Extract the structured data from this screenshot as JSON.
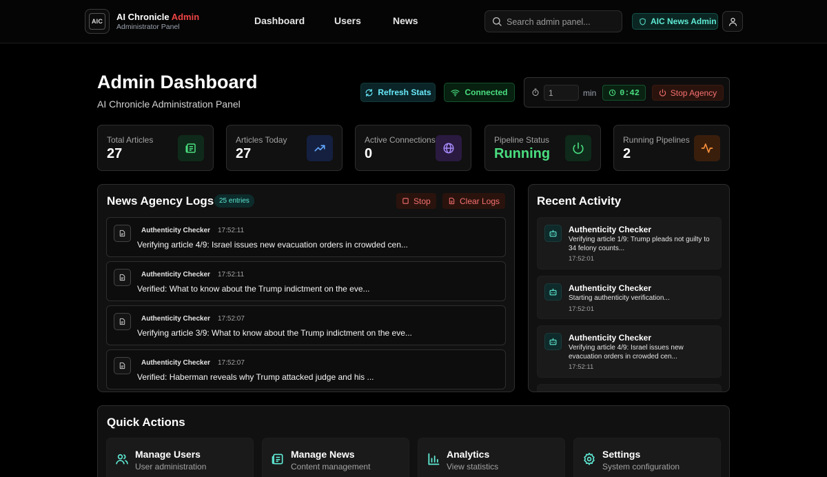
{
  "brand": {
    "logo_text": "AIC",
    "title_main": "AI Chronicle",
    "title_accent": "Admin",
    "subtitle": "Administrator Panel"
  },
  "nav": {
    "dashboard": "Dashboard",
    "users": "Users",
    "news": "News"
  },
  "search": {
    "placeholder": "Search admin panel..."
  },
  "admin_badge": "AIC News Admin",
  "page": {
    "title": "Admin Dashboard",
    "subtitle": "AI Chronicle Administration Panel"
  },
  "controls": {
    "refresh_label": "Refresh Stats",
    "connected_label": "Connected",
    "interval_value": "1",
    "interval_unit": "min",
    "countdown": "0:42",
    "stop_agency_label": "Stop Agency"
  },
  "stats": [
    {
      "label": "Total Articles",
      "value": "27"
    },
    {
      "label": "Articles Today",
      "value": "27"
    },
    {
      "label": "Active Connections",
      "value": "0"
    },
    {
      "label": "Pipeline Status",
      "value": "Running"
    },
    {
      "label": "Running Pipelines",
      "value": "2"
    }
  ],
  "logs": {
    "title": "News Agency Logs",
    "entries_badge": "25 entries",
    "stop_label": "Stop",
    "clear_label": "Clear Logs",
    "items": [
      {
        "source": "Authenticity Checker",
        "time": "17:52:11",
        "message": "Verifying article 4/9: Israel issues new evacuation orders in crowded cen..."
      },
      {
        "source": "Authenticity Checker",
        "time": "17:52:11",
        "message": "Verified: What to know about the Trump indictment on the eve..."
      },
      {
        "source": "Authenticity Checker",
        "time": "17:52:07",
        "message": "Verifying article 3/9: What to know about the Trump indictment on the eve..."
      },
      {
        "source": "Authenticity Checker",
        "time": "17:52:07",
        "message": "Verified: Haberman reveals why Trump attacked judge and his ..."
      }
    ]
  },
  "activity": {
    "title": "Recent Activity",
    "items": [
      {
        "title": "Authenticity Checker",
        "desc": "Verifying article 1/9: Trump pleads not guilty to 34 felony counts...",
        "time": "17:52:01"
      },
      {
        "title": "Authenticity Checker",
        "desc": "Starting authenticity verification...",
        "time": "17:52:01"
      },
      {
        "title": "Authenticity Checker",
        "desc": "Verifying article 4/9: Israel issues new evacuation orders in crowded cen...",
        "time": "17:52:11"
      }
    ]
  },
  "quick_actions": {
    "title": "Quick Actions",
    "items": [
      {
        "title": "Manage Users",
        "sub": "User administration"
      },
      {
        "title": "Manage News",
        "sub": "Content management"
      },
      {
        "title": "Analytics",
        "sub": "View statistics"
      },
      {
        "title": "Settings",
        "sub": "System configuration"
      }
    ]
  },
  "colors": {
    "accent_teal": "#5eead4",
    "status_green": "#4ade80",
    "danger_red": "#f87171",
    "brand_red": "#ef4444"
  }
}
